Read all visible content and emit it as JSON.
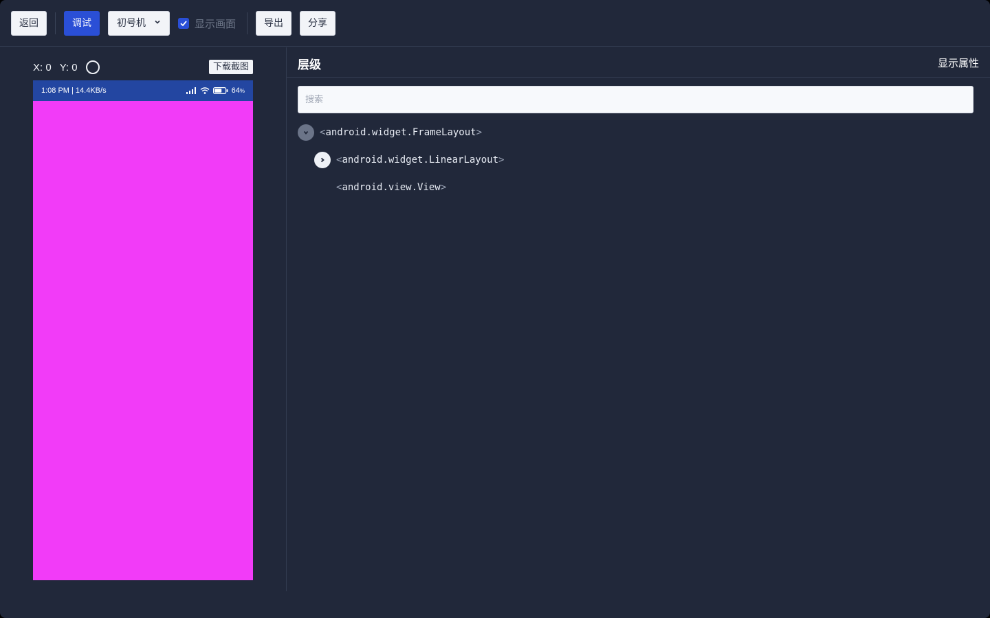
{
  "toolbar": {
    "back_label": "返回",
    "debug_label": "调试",
    "device_selected": "初号机",
    "show_screen_label": "显示画面",
    "show_screen_checked": true,
    "export_label": "导出",
    "share_label": "分享"
  },
  "preview": {
    "x_label": "X: 0",
    "y_label": "Y: 0",
    "download_label": "下载截图",
    "statusbar": {
      "time_speed": "1:08 PM | 14.4KB/s",
      "battery": "64"
    },
    "screen_color": "#f23bf8",
    "statusbar_color": "#2346a1"
  },
  "hierarchy": {
    "title": "层级",
    "show_props_label": "显示属性",
    "search_placeholder": "搜索",
    "nodes": [
      {
        "label": "android.widget.FrameLayout",
        "state": "expanded",
        "depth": 0
      },
      {
        "label": "android.widget.LinearLayout",
        "state": "collapsed",
        "depth": 1
      },
      {
        "label": "android.view.View",
        "state": "leaf",
        "depth": 2
      }
    ]
  },
  "colors": {
    "background": "#21283a",
    "accent": "#2a4fd6"
  }
}
